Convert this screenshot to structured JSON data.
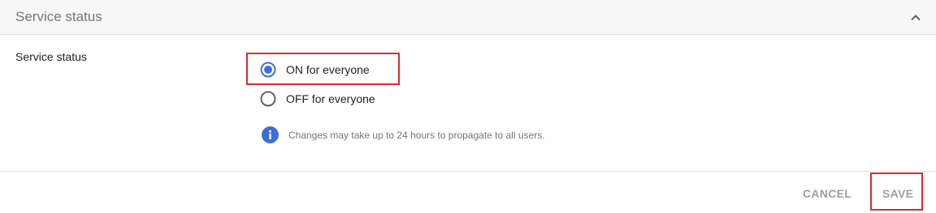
{
  "header": {
    "title": "Service status",
    "collapse_icon": "chevron-up-icon"
  },
  "setting": {
    "label": "Service status",
    "options": [
      {
        "label": "ON for everyone",
        "selected": true
      },
      {
        "label": "OFF for everyone",
        "selected": false
      }
    ],
    "info_icon": "info-icon",
    "info_text": "Changes may take up to 24 hours to propagate to all users."
  },
  "actions": {
    "cancel_label": "CANCEL",
    "save_label": "SAVE"
  },
  "colors": {
    "accent": "#3d6fd6",
    "radio_unselected": "#616161",
    "highlight": "#d32f2f",
    "button_disabled": "#9e9e9e"
  }
}
